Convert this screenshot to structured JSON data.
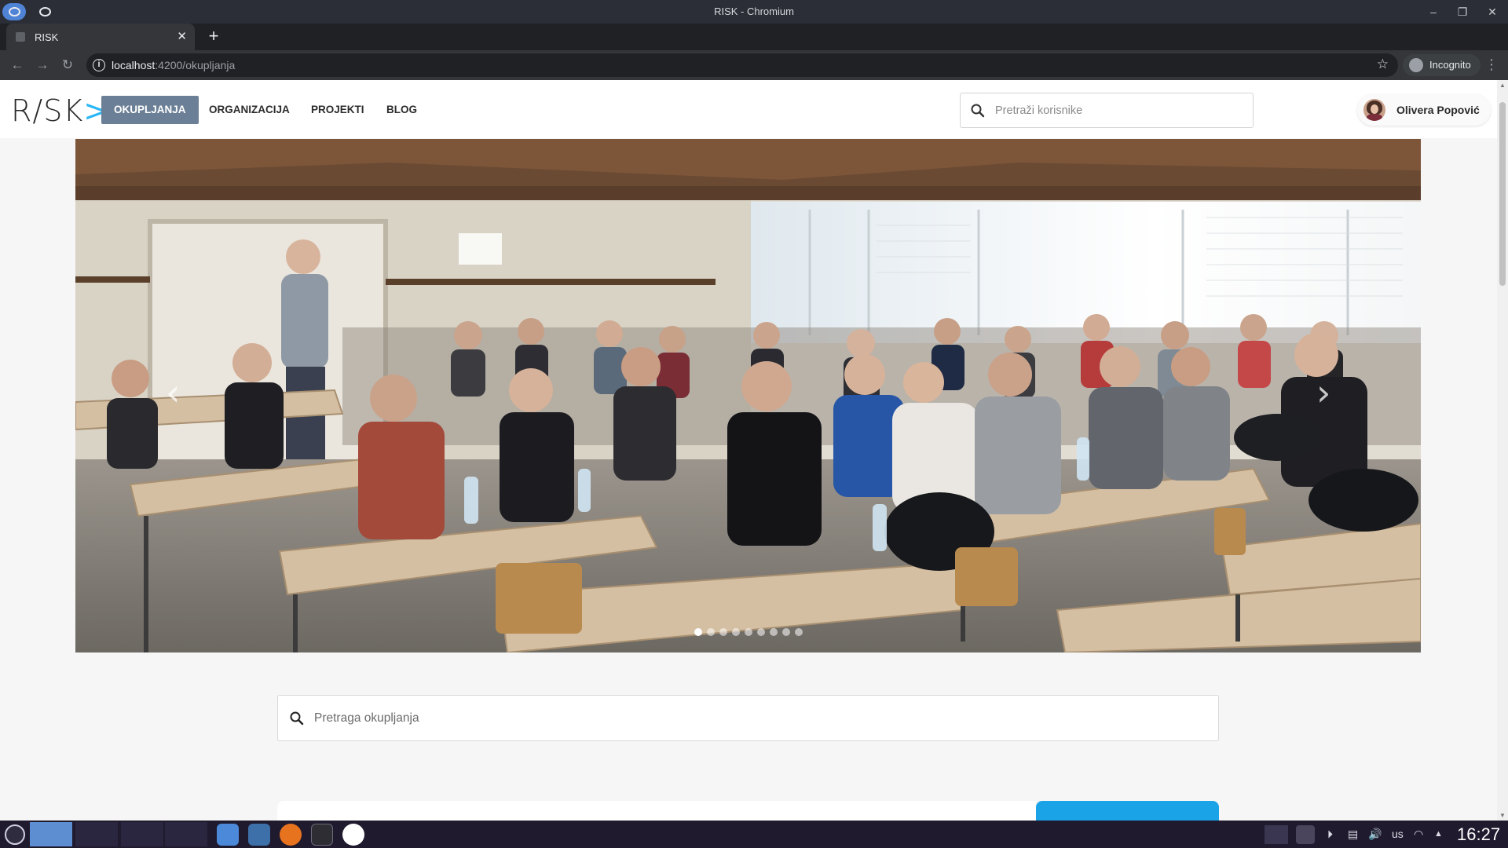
{
  "window": {
    "title": "RISK - Chromium"
  },
  "browser": {
    "tab_title": "RISK",
    "url_host": "localhost",
    "url_path": ":4200/okupljanja",
    "incognito_label": "Incognito"
  },
  "navbar": {
    "logo_text": "R/SK",
    "logo_chevron": ">",
    "items": [
      "OKUPLJANJA",
      "ORGANIZACIJA",
      "PROJEKTI",
      "BLOG"
    ],
    "active_item": "OKUPLJANJA",
    "user_search_placeholder": "Pretraži korisnike",
    "user_name": "Olivera Popović"
  },
  "carousel": {
    "slide_count": 9,
    "active_index": 0,
    "prev_symbol": "‹",
    "next_symbol": "›"
  },
  "meetup_search": {
    "placeholder": "Pretraga okupljanja"
  },
  "taskbar": {
    "keyboard_layout": "us",
    "clock": "16:27"
  },
  "colors": {
    "accent_nav": "#6b7f96",
    "logo_chevron": "#29b6f6",
    "button_blue": "#1ba3e8",
    "taskbar": "#1f1a2e"
  }
}
